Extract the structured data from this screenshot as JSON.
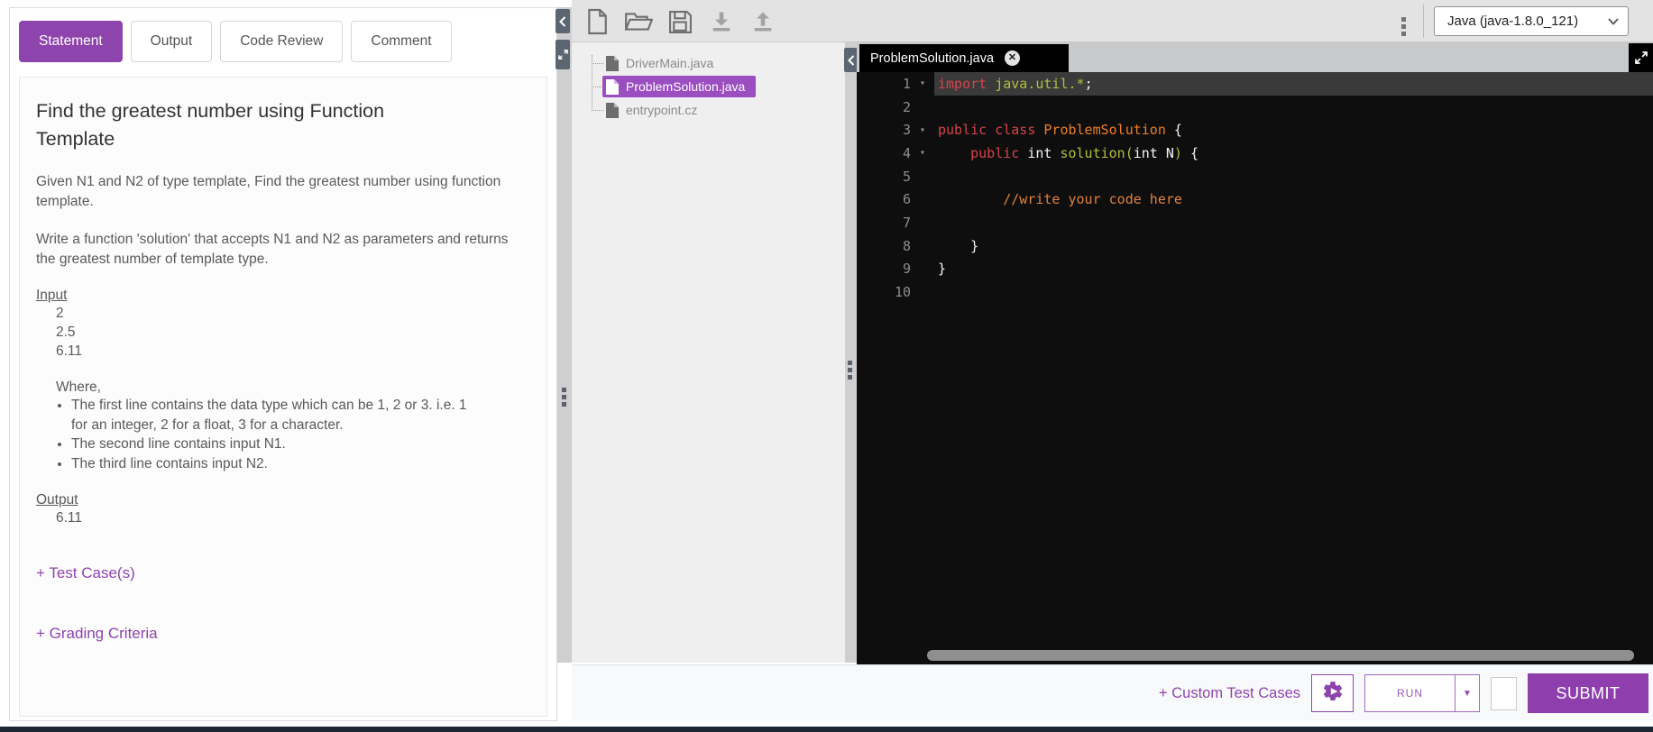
{
  "left_panel": {
    "tabs": [
      {
        "label": "Statement",
        "active": true
      },
      {
        "label": "Output",
        "active": false
      },
      {
        "label": "Code Review",
        "active": false
      },
      {
        "label": "Comment",
        "active": false
      }
    ],
    "statement": {
      "title": "Find the greatest number using Function Template",
      "paragraph1": "Given N1 and N2 of type template, Find the greatest number using function template.",
      "paragraph2": "Write a function 'solution' that accepts N1 and N2 as parameters and returns the greatest number of template type.",
      "input_label": "Input",
      "input_values": [
        "2",
        "2.5",
        "6.11"
      ],
      "where_label": "Where,",
      "bullets": [
        "The first line contains the data type which can be 1, 2 or 3. i.e. 1 for an integer, 2 for a float, 3 for a character.",
        "The second line contains input N1.",
        "The third line contains input N2."
      ],
      "output_label": "Output",
      "output_value": "6.11",
      "test_cases_link": "+ Test Case(s)",
      "grading_criteria_link": "+ Grading Criteria"
    }
  },
  "toolbar": {
    "icons": [
      "new-file",
      "open-folder",
      "save",
      "download",
      "upload"
    ]
  },
  "header": {
    "language_selector": "Java (java-1.8.0_121)"
  },
  "file_panel": {
    "files": [
      {
        "name": "DriverMain.java",
        "selected": false
      },
      {
        "name": "ProblemSolution.java",
        "selected": true
      },
      {
        "name": "entrypoint.cz",
        "selected": false
      }
    ]
  },
  "editor": {
    "tab_title": "ProblemSolution.java",
    "syntax_colors": {
      "keyword": "#d5444c",
      "class": "#ee7e2c",
      "function": "#b0bf3f",
      "comment": "#e0813d",
      "plain": "#f5f5f5",
      "gutter": "#8d8d8d",
      "background": "#0e0e0e",
      "active_line": "#3a3a3a"
    },
    "lines": [
      {
        "n": 1,
        "fold": true,
        "active": true,
        "tokens": [
          {
            "t": "import",
            "c": "kw"
          },
          {
            "t": " ",
            "c": "pl"
          },
          {
            "t": "java.util.*",
            "c": "fn"
          },
          {
            "t": ";",
            "c": "pl"
          }
        ]
      },
      {
        "n": 2,
        "tokens": []
      },
      {
        "n": 3,
        "fold": true,
        "tokens": [
          {
            "t": "public class",
            "c": "kw"
          },
          {
            "t": " ",
            "c": "pl"
          },
          {
            "t": "ProblemSolution",
            "c": "cls"
          },
          {
            "t": " {",
            "c": "pl"
          }
        ]
      },
      {
        "n": 4,
        "fold": true,
        "tokens": [
          {
            "t": "    ",
            "c": "pl"
          },
          {
            "t": "public",
            "c": "kw"
          },
          {
            "t": " int ",
            "c": "pl"
          },
          {
            "t": "solution",
            "c": "fn"
          },
          {
            "t": "(",
            "c": "fn"
          },
          {
            "t": "int N",
            "c": "pl"
          },
          {
            "t": ")",
            "c": "fn"
          },
          {
            "t": " {",
            "c": "pl"
          }
        ]
      },
      {
        "n": 5,
        "tokens": []
      },
      {
        "n": 6,
        "tokens": [
          {
            "t": "        ",
            "c": "pl"
          },
          {
            "t": "//write your code here",
            "c": "cmt"
          }
        ]
      },
      {
        "n": 7,
        "tokens": []
      },
      {
        "n": 8,
        "tokens": [
          {
            "t": "    }",
            "c": "pl"
          }
        ]
      },
      {
        "n": 9,
        "tokens": [
          {
            "t": "}",
            "c": "pl"
          }
        ]
      },
      {
        "n": 10,
        "tokens": []
      }
    ]
  },
  "bottom_bar": {
    "custom_test_cases_label": "+ Custom Test Cases",
    "run_label": "RUN",
    "submit_label": "SUBMIT"
  },
  "colors": {
    "accent_purple": "#8e44ad",
    "submit_purple": "#8e3fad",
    "selection_purple": "#9a4ec0",
    "splitter_gray": "#cfcfcf",
    "handle_slate": "#5c6670",
    "bottom_edge": "#1d2633"
  }
}
